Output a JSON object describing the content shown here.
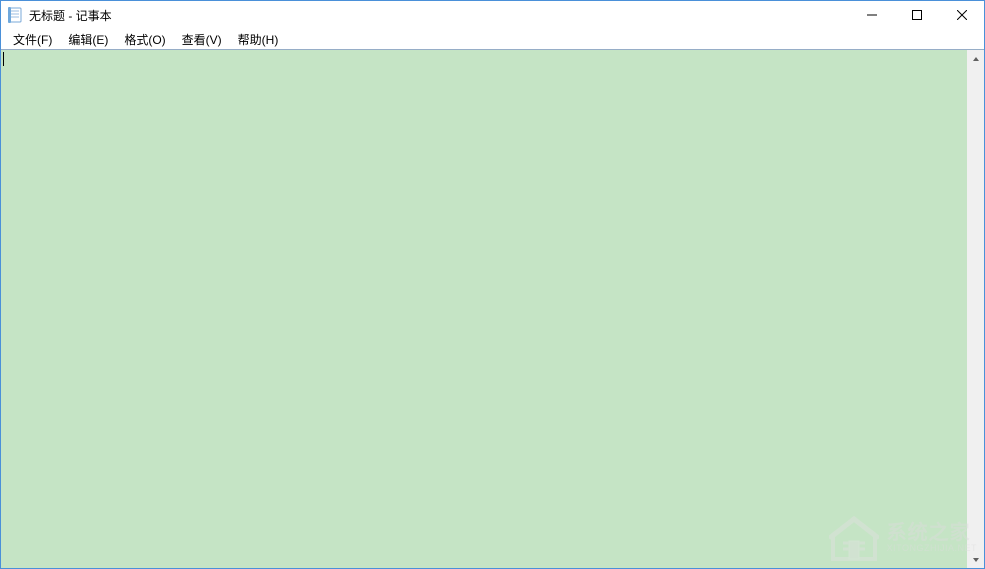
{
  "window": {
    "title": "无标题 - 记事本"
  },
  "menu": {
    "items": [
      {
        "label": "文件(F)"
      },
      {
        "label": "编辑(E)"
      },
      {
        "label": "格式(O)"
      },
      {
        "label": "查看(V)"
      },
      {
        "label": "帮助(H)"
      }
    ]
  },
  "editor": {
    "content": "",
    "background_color": "#c5e4c5"
  },
  "watermark": {
    "cn": "系统之家",
    "en": "XITONGZHIJIA.NET"
  }
}
